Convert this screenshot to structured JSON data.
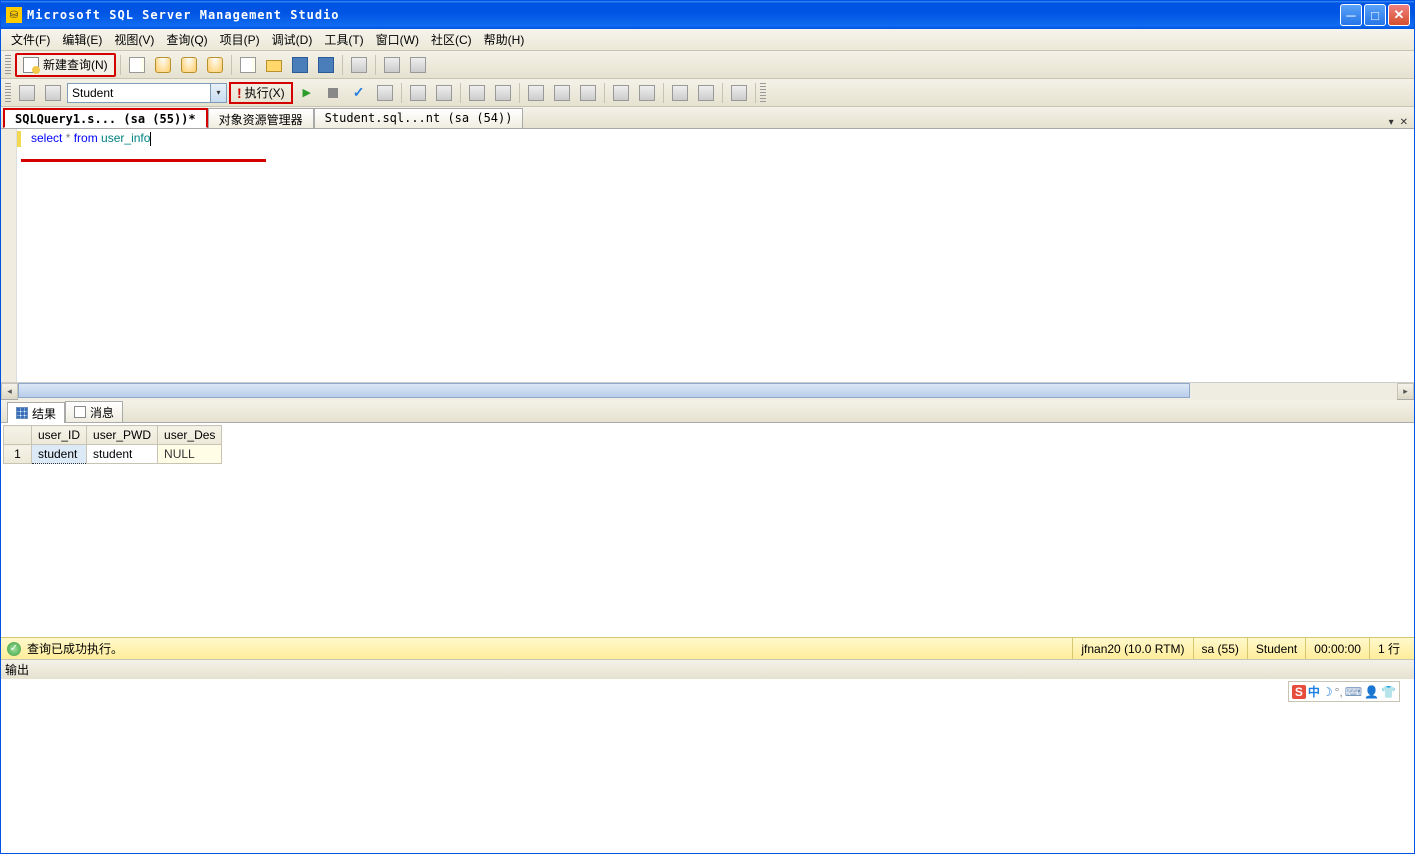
{
  "titlebar": {
    "title": "Microsoft SQL Server Management Studio"
  },
  "menu": {
    "file": "文件(F)",
    "edit": "编辑(E)",
    "view": "视图(V)",
    "query": "查询(Q)",
    "project": "项目(P)",
    "debug": "调试(D)",
    "tools": "工具(T)",
    "window": "窗口(W)",
    "community": "社区(C)",
    "help": "帮助(H)"
  },
  "toolbar": {
    "new_query": "新建查询(N)"
  },
  "toolbar2": {
    "database": "Student",
    "execute": "执行(X)"
  },
  "tabs": {
    "t1": "SQLQuery1.s... (sa (55))*",
    "t2": "对象资源管理器",
    "t3": "Student.sql...nt (sa (54))"
  },
  "editor": {
    "kw_select": "select",
    "star": " * ",
    "kw_from": "from",
    "sp": " ",
    "ident": "user_info"
  },
  "result_tabs": {
    "results": "结果",
    "messages": "消息"
  },
  "grid": {
    "headers": {
      "c1": "user_ID",
      "c2": "user_PWD",
      "c3": "user_Des"
    },
    "row1": {
      "n": "1",
      "c1": "student",
      "c2": "student",
      "c3": "NULL"
    }
  },
  "status": {
    "msg": "查询已成功执行。",
    "server": "jfnan20 (10.0 RTM)",
    "login": "sa (55)",
    "db": "Student",
    "time": "00:00:00",
    "rows": "1 行"
  },
  "output": {
    "label": "输出"
  },
  "ime": {
    "s": "S",
    "zh": "中"
  }
}
